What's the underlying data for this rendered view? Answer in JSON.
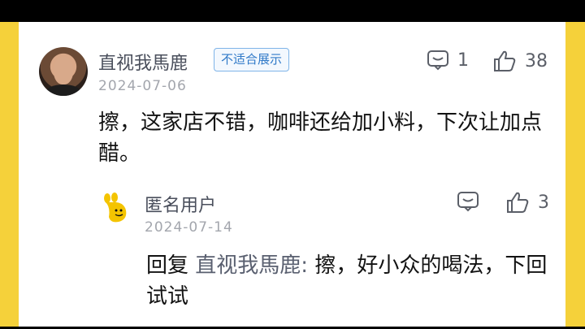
{
  "main_comment": {
    "username": "直视我馬鹿",
    "badge": "不适合展示",
    "date": "2024-07-06",
    "reply_count": "1",
    "like_count": "38",
    "text": "擦，这家店不错，咖啡还给加小料，下次让加点醋。"
  },
  "reply": {
    "username": "匿名用户",
    "date": "2024-07-14",
    "like_count": "3",
    "prefix": "回复",
    "target": "直视我馬鹿:",
    "text": "擦，好小众的喝法，下回试试"
  },
  "icons": {
    "comment": "comment-bubble-icon",
    "like": "thumbs-up-icon",
    "anonymous_avatar": "anonymous-yellow-character-icon"
  },
  "colors": {
    "frame": "#f5d13a",
    "badge_text": "#2f79c8",
    "badge_border": "#7fb4e8"
  }
}
